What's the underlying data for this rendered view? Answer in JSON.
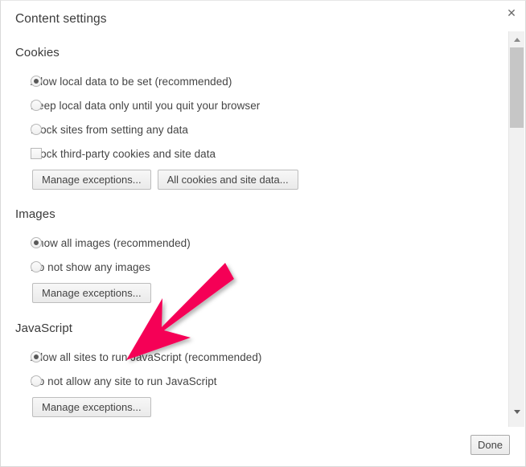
{
  "dialog": {
    "title": "Content settings",
    "close_icon": "close-icon"
  },
  "sections": [
    {
      "heading": "Cookies",
      "options": [
        {
          "type": "radio",
          "label": "Allow local data to be set (recommended)",
          "checked": true
        },
        {
          "type": "radio",
          "label": "Keep local data only until you quit your browser",
          "checked": false
        },
        {
          "type": "radio",
          "label": "Block sites from setting any data",
          "checked": false
        },
        {
          "type": "checkbox",
          "label": "Block third-party cookies and site data",
          "checked": false
        }
      ],
      "buttons": [
        "Manage exceptions...",
        "All cookies and site data..."
      ]
    },
    {
      "heading": "Images",
      "options": [
        {
          "type": "radio",
          "label": "Show all images (recommended)",
          "checked": true
        },
        {
          "type": "radio",
          "label": "Do not show any images",
          "checked": false
        }
      ],
      "buttons": [
        "Manage exceptions..."
      ]
    },
    {
      "heading": "JavaScript",
      "options": [
        {
          "type": "radio",
          "label": "Allow all sites to run JavaScript (recommended)",
          "checked": true
        },
        {
          "type": "radio",
          "label": "Do not allow any site to run JavaScript",
          "checked": false
        }
      ],
      "buttons": [
        "Manage exceptions..."
      ]
    }
  ],
  "footer": {
    "done_label": "Done"
  },
  "scrollbar": {
    "up_icon": "triangle-up-icon",
    "down_icon": "triangle-down-icon"
  },
  "annotation": {
    "type": "arrow",
    "color": "#F50057",
    "points_to": "Allow all sites to run JavaScript (recommended)"
  }
}
